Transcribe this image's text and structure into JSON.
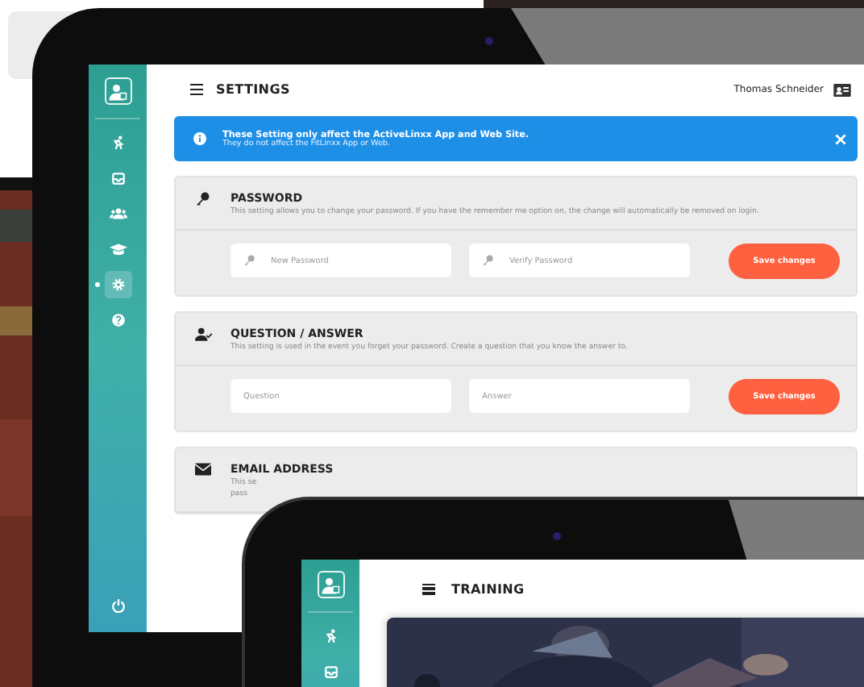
{
  "settings_screen": {
    "title": "SETTINGS",
    "user_name": "Thomas Schneider",
    "sidebar": {
      "items": [
        {
          "selected": false
        },
        {
          "selected": false
        },
        {
          "selected": false
        },
        {
          "selected": false
        },
        {
          "selected": true
        },
        {
          "selected": false
        }
      ]
    },
    "alert": {
      "title": "These Setting only affect the ActiveLinxx App and Web Site.",
      "message": "They do not affect the FitLinxx App or Web."
    },
    "sections": [
      {
        "title": "PASSWORD",
        "description_lines": [
          "This setting allows you to change your password. If you have the remember me option on, the change will automatically be removed on login."
        ],
        "fields": [
          {
            "kind": "password",
            "placeholder": "New Password"
          },
          {
            "kind": "password",
            "placeholder": "Verify Password"
          }
        ],
        "button": "Save changes"
      },
      {
        "title": "QUESTION / ANSWER",
        "description_lines": [
          "This setting is used in the event you forget your password. Create a question that you know the answer to."
        ],
        "fields": [
          {
            "kind": "plain",
            "placeholder": "Question"
          },
          {
            "kind": "plain",
            "placeholder": "Answer"
          }
        ],
        "button": "Save changes"
      },
      {
        "title": "EMAIL ADDRESS",
        "description_lines": [
          "This se",
          "pass"
        ]
      }
    ]
  },
  "training_screen": {
    "title": "TRAINING"
  }
}
